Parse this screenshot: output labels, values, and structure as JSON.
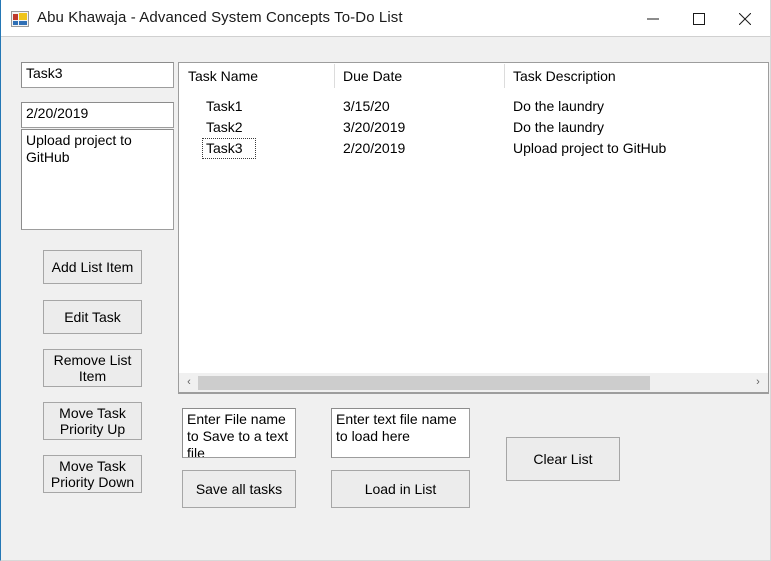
{
  "window": {
    "title": "Abu Khawaja - Advanced System Concepts To-Do List",
    "icon": "winforms-app-icon",
    "controls": {
      "minimize": "minimize-button",
      "maximize": "maximize-button",
      "close": "close-button"
    }
  },
  "form": {
    "task_name_value": "Task3",
    "task_name_placeholder": "",
    "due_date_value": "2/20/2019",
    "due_date_placeholder": "",
    "description_value": "Upload project to GitHub",
    "description_placeholder": ""
  },
  "side_buttons": [
    {
      "label": "Add List Item",
      "name": "add-list-item-button"
    },
    {
      "label": "Edit Task",
      "name": "edit-task-button"
    },
    {
      "label": "Remove List\nItem",
      "name": "remove-list-item-button"
    },
    {
      "label": "Move Task\nPriority Up",
      "name": "move-task-priority-up-button"
    },
    {
      "label": "Move Task\nPriority Down",
      "name": "move-task-priority-down-button"
    }
  ],
  "listview": {
    "columns": [
      "Task Name",
      "Due Date",
      "Task Description"
    ],
    "rows": [
      {
        "task_name": "Task1",
        "due_date": "3/15/20",
        "description": "Do the laundry",
        "focused": false
      },
      {
        "task_name": "Task2",
        "due_date": "3/20/2019",
        "description": "Do the laundry",
        "focused": false
      },
      {
        "task_name": "Task3",
        "due_date": "2/20/2019",
        "description": "Upload project to GitHub",
        "focused": true
      }
    ],
    "scrollbar": {
      "left_arrow": "‹",
      "right_arrow": "›"
    }
  },
  "file_panel": {
    "save_filename_value": "Enter File name to Save to a text file",
    "save_filename_placeholder": "",
    "load_filename_value": "Enter text file name to load here",
    "load_filename_placeholder": "",
    "save_button_label": "Save all tasks",
    "load_button_label": "Load in List",
    "clear_button_label": "Clear List"
  },
  "colors": {
    "window_background": "#f0f0f0",
    "titlebar_background": "#ffffff",
    "accent_border": "#2477b5",
    "control_face": "#ececec",
    "control_border": "#a6a6a6",
    "field_background": "#ffffff",
    "field_border": "#9d9d9d",
    "text": "#000000",
    "scrollbar_thumb": "#cdcdcd"
  }
}
